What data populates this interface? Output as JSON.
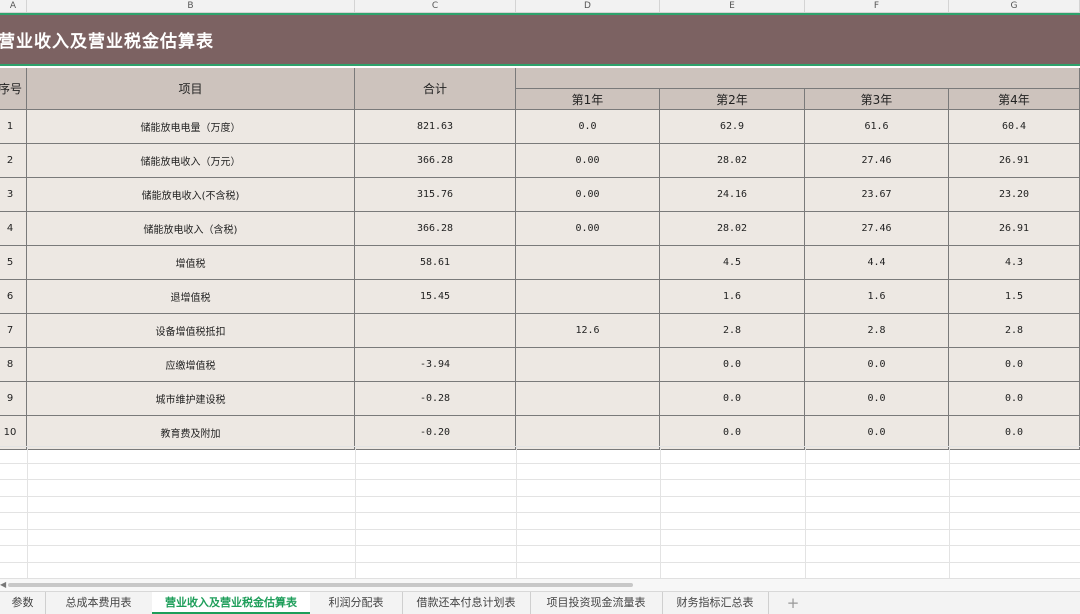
{
  "columns": [
    "A",
    "B",
    "C",
    "D",
    "E",
    "F",
    "G"
  ],
  "title": "营业收入及营业税金估算表",
  "headers": {
    "seq": "序号",
    "item": "项目",
    "total": "合计",
    "years": [
      "第1年",
      "第2年",
      "第3年",
      "第4年"
    ]
  },
  "rows": [
    {
      "seq": "1",
      "item": "储能放电电量（万度）",
      "total": "821.63",
      "y1": "0.0",
      "y2": "62.9",
      "y3": "61.6",
      "y4": "60.4"
    },
    {
      "seq": "2",
      "item": "储能放电收入（万元）",
      "total": "366.28",
      "y1": "0.00",
      "y2": "28.02",
      "y3": "27.46",
      "y4": "26.91"
    },
    {
      "seq": "3",
      "item": "储能放电收入(不含税)",
      "total": "315.76",
      "y1": "0.00",
      "y2": "24.16",
      "y3": "23.67",
      "y4": "23.20"
    },
    {
      "seq": "4",
      "item": "储能放电收入（含税)",
      "total": "366.28",
      "y1": "0.00",
      "y2": "28.02",
      "y3": "27.46",
      "y4": "26.91"
    },
    {
      "seq": "5",
      "item": "增值税",
      "total": "58.61",
      "y1": "",
      "y2": "4.5",
      "y3": "4.4",
      "y4": "4.3"
    },
    {
      "seq": "6",
      "item": "退增值税",
      "total": "15.45",
      "y1": "",
      "y2": "1.6",
      "y3": "1.6",
      "y4": "1.5"
    },
    {
      "seq": "7",
      "item": "设备增值税抵扣",
      "total": "",
      "y1": "12.6",
      "y2": "2.8",
      "y3": "2.8",
      "y4": "2.8"
    },
    {
      "seq": "8",
      "item": "应缴增值税",
      "total": "-3.94",
      "y1": "",
      "y2": "0.0",
      "y3": "0.0",
      "y4": "0.0"
    },
    {
      "seq": "9",
      "item": "城市维护建设税",
      "total": "-0.28",
      "y1": "",
      "y2": "0.0",
      "y3": "0.0",
      "y4": "0.0"
    },
    {
      "seq": "10",
      "item": "教育费及附加",
      "total": "-0.20",
      "y1": "",
      "y2": "0.0",
      "y3": "0.0",
      "y4": "0.0"
    }
  ],
  "sheet_tabs": [
    "参数",
    "总成本费用表",
    "营业收入及营业税金估算表",
    "利润分配表",
    "借款还本付息计划表",
    "项目投资现金流量表",
    "财务指标汇总表"
  ],
  "active_tab": "营业收入及营业税金估算表",
  "add_sheet": "+",
  "colors": {
    "title_bg": "#7c6262",
    "header_bg": "#cdc3bd",
    "body_bg": "#ede8e3",
    "accent": "#1e9e5a"
  }
}
